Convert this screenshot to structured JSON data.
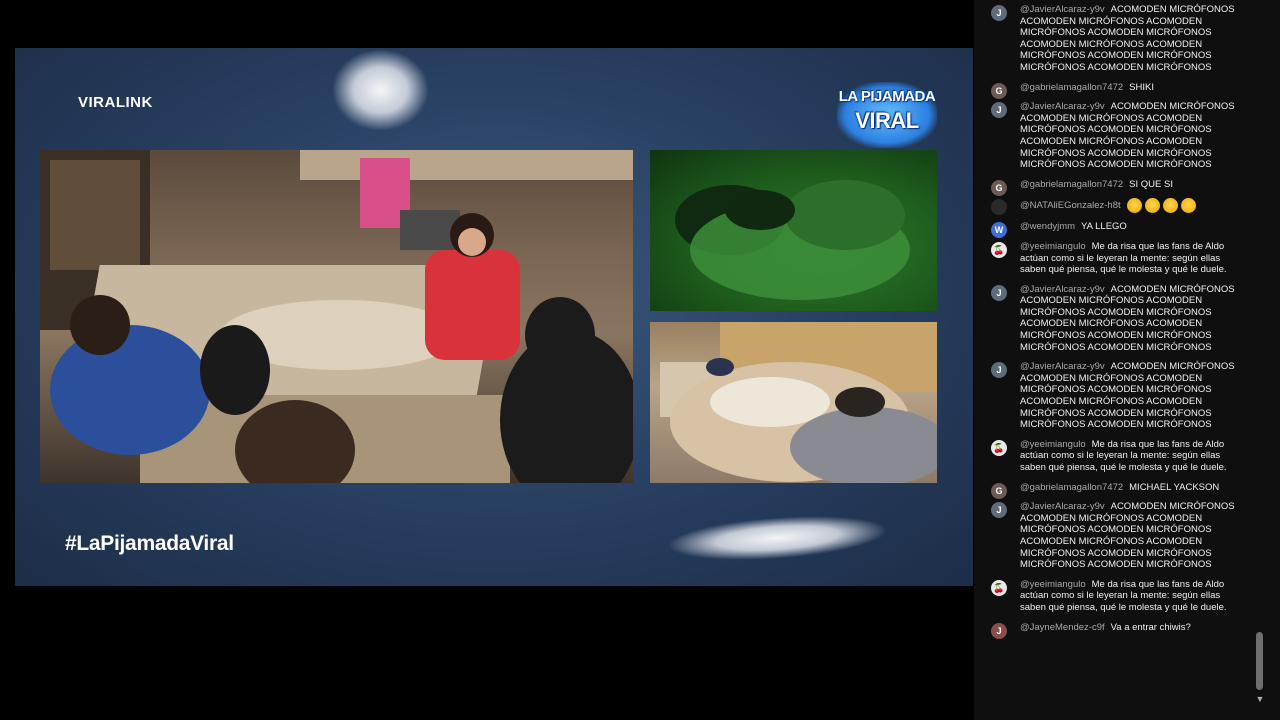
{
  "video": {
    "brand": "VIRALINK",
    "hashtag": "#LaPijamadaViral",
    "logo_line1": "LA PIJAMADA",
    "logo_line2": "VIRAL"
  },
  "chat": {
    "messages": [
      {
        "author": "@JavierAlcaraz-y9v",
        "avatar": "J",
        "avatar_color": "#5d6b7a",
        "lines": [
          "ACOMODEN MICRÓFONOS",
          "ACOMODEN MICRÓFONOS ACOMODEN",
          "MICRÓFONOS ACOMODEN MICRÓFONOS",
          "ACOMODEN MICRÓFONOS ACOMODEN",
          "MICRÓFONOS ACOMODEN MICRÓFONOS",
          "MICRÓFONOS ACOMODEN MICRÓFONOS"
        ]
      },
      {
        "author": "@gabrielamagallon7472",
        "avatar": "G",
        "avatar_color": "#6b5a56",
        "lines": [
          "SHIKI"
        ]
      },
      {
        "author": "@JavierAlcaraz-y9v",
        "avatar": "J",
        "avatar_color": "#5d6b7a",
        "lines": [
          "ACOMODEN MICRÓFONOS",
          "ACOMODEN MICRÓFONOS ACOMODEN",
          "MICRÓFONOS ACOMODEN MICRÓFONOS",
          "ACOMODEN MICRÓFONOS ACOMODEN",
          "MICRÓFONOS ACOMODEN MICRÓFONOS",
          "MICRÓFONOS ACOMODEN MICRÓFONOS"
        ]
      },
      {
        "author": "@gabrielamagallon7472",
        "avatar": "G",
        "avatar_color": "#6b5a56",
        "lines": [
          "SI QUE SI"
        ]
      },
      {
        "author": "@NATAliEGonzalez-h8t",
        "avatar": "",
        "avatar_color": "#2a2a2a",
        "lines": [],
        "emoji_count": 4
      },
      {
        "author": "@wendyjmm",
        "avatar": "W",
        "avatar_color": "#3d6fd6",
        "lines": [
          "YA LLEGO"
        ]
      },
      {
        "author": "@yeeimiangulo",
        "avatar": "🍒",
        "avatar_color": "#e9e9e9",
        "lines": [
          "Me da risa que las fans de Aldo",
          "actúan como si le leyeran la mente: según ellas",
          "saben qué piensa, qué le molesta y qué le duele."
        ]
      },
      {
        "author": "@JavierAlcaraz-y9v",
        "avatar": "J",
        "avatar_color": "#5d6b7a",
        "lines": [
          "ACOMODEN MICRÓFONOS",
          "ACOMODEN MICRÓFONOS ACOMODEN",
          "MICRÓFONOS ACOMODEN MICRÓFONOS",
          "ACOMODEN MICRÓFONOS ACOMODEN",
          "MICRÓFONOS ACOMODEN MICRÓFONOS",
          "MICRÓFONOS ACOMODEN MICRÓFONOS"
        ]
      },
      {
        "author": "@JavierAlcaraz-y9v",
        "avatar": "J",
        "avatar_color": "#5d6b7a",
        "lines": [
          "ACOMODEN MICRÓFONOS",
          "ACOMODEN MICRÓFONOS ACOMODEN",
          "MICRÓFONOS ACOMODEN MICRÓFONOS",
          "ACOMODEN MICRÓFONOS ACOMODEN",
          "MICRÓFONOS ACOMODEN MICRÓFONOS",
          "MICRÓFONOS ACOMODEN MICRÓFONOS"
        ]
      },
      {
        "author": "@yeeimiangulo",
        "avatar": "🍒",
        "avatar_color": "#e9e9e9",
        "lines": [
          "Me da risa que las fans de Aldo",
          "actúan como si le leyeran la mente: según ellas",
          "saben qué piensa, qué le molesta y qué le duele."
        ]
      },
      {
        "author": "@gabrielamagallon7472",
        "avatar": "G",
        "avatar_color": "#6b5a56",
        "lines": [
          "MICHAEL YACKSON"
        ]
      },
      {
        "author": "@JavierAlcaraz-y9v",
        "avatar": "J",
        "avatar_color": "#5d6b7a",
        "lines": [
          "ACOMODEN MICRÓFONOS",
          "ACOMODEN MICRÓFONOS ACOMODEN",
          "MICRÓFONOS ACOMODEN MICRÓFONOS",
          "ACOMODEN MICRÓFONOS ACOMODEN",
          "MICRÓFONOS ACOMODEN MICRÓFONOS",
          "MICRÓFONOS ACOMODEN MICRÓFONOS"
        ]
      },
      {
        "author": "@yeeimiangulo",
        "avatar": "🍒",
        "avatar_color": "#e9e9e9",
        "lines": [
          "Me da risa que las fans de Aldo",
          "actúan como si le leyeran la mente: según ellas",
          "saben qué piensa, qué le molesta y qué le duele."
        ]
      },
      {
        "author": "@JayneMendez-c9f",
        "avatar": "J",
        "avatar_color": "#8a4d4d",
        "lines": [
          "Va a entrar chiwis?"
        ]
      }
    ]
  }
}
